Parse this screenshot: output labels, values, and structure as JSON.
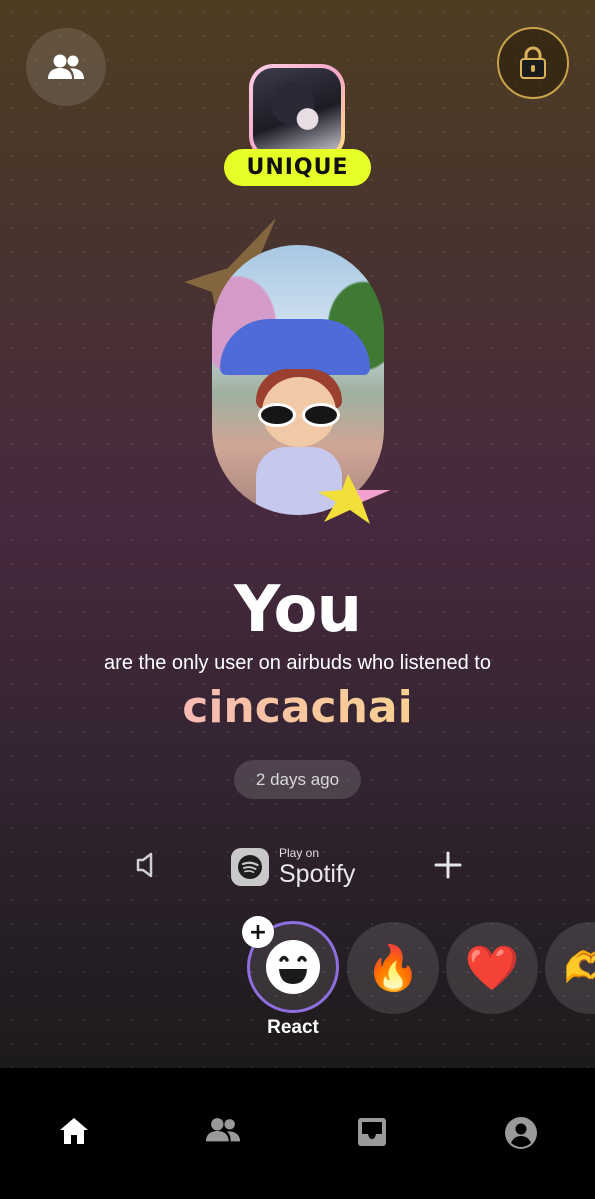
{
  "header": {
    "friends_icon": "people-icon",
    "shop_icon": "lock-bag-icon",
    "badge_label": "UNIQUE",
    "accent_color": "#e6ff27"
  },
  "main": {
    "headline": "You",
    "subline": "are the only user on airbuds who listened to",
    "artist": "cincachai",
    "time_ago": "2 days ago"
  },
  "player": {
    "mute_icon": "speaker-mute-icon",
    "play_on_label": "Play on",
    "service": "Spotify",
    "add_icon": "plus-icon"
  },
  "reactions": {
    "label": "React",
    "items": [
      "🔥",
      "❤️",
      "🫶"
    ]
  },
  "bottom_nav": {
    "items": [
      "home-icon",
      "friends-icon",
      "inbox-icon",
      "profile-icon"
    ]
  }
}
